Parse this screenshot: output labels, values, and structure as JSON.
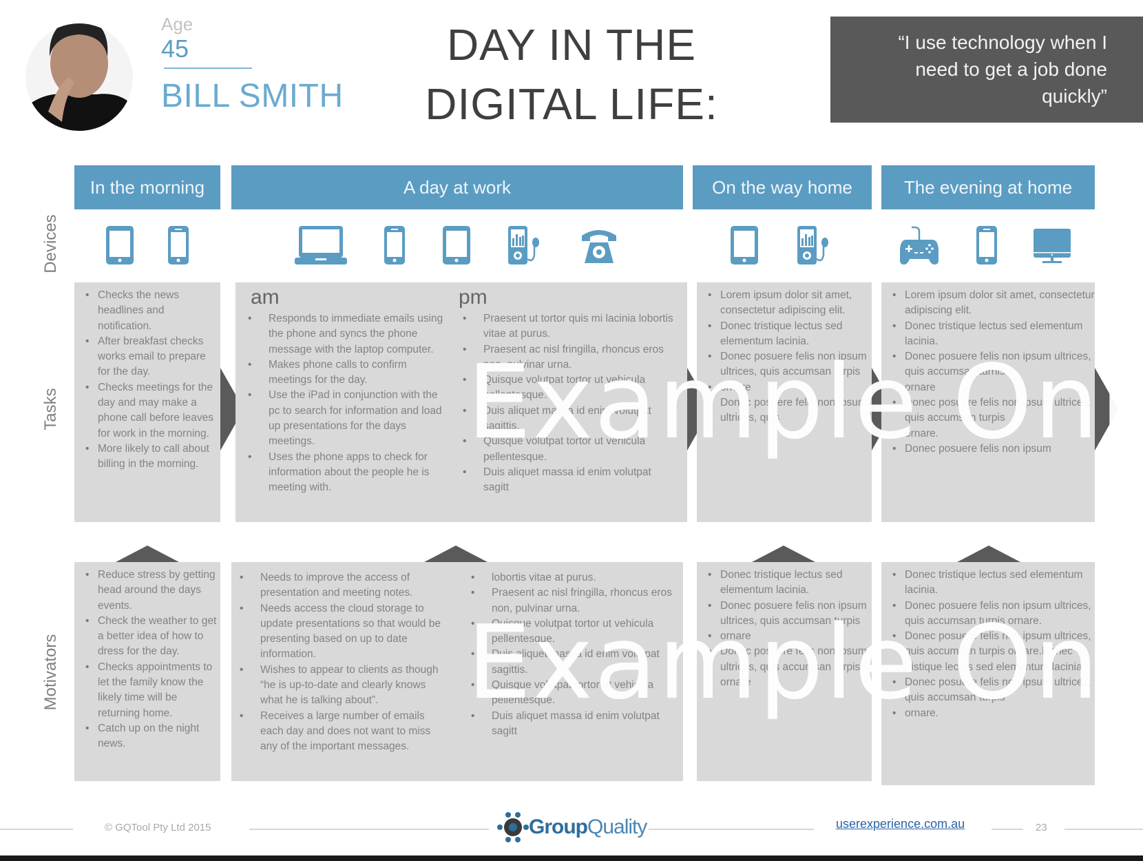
{
  "persona": {
    "age_label": "Age",
    "age_value": "45",
    "name": "BILL SMITH",
    "avatar_icon": "person-portrait-icon"
  },
  "title_line1": "DAY IN THE",
  "title_line2": "DIGITAL LIFE:",
  "quote": "“I use technology when I need to get a job done quickly”",
  "row_labels": {
    "devices": "Devices",
    "tasks": "Tasks",
    "motivators": "Motivators"
  },
  "colors": {
    "accent": "#5b9cc2",
    "box_bg": "#d9d9d9",
    "dark_gray": "#595959"
  },
  "phases": [
    {
      "label": "In the morning",
      "devices": [
        "tablet-icon",
        "smartphone-icon"
      ],
      "tasks": [
        "Checks the news headlines and notification.",
        "After breakfast checks works email to prepare for the day.",
        "Checks meetings for the day and may make a phone call before leaves for work in the morning.",
        "More likely to call about billing in the morning."
      ],
      "motivators": [
        "Reduce stress by getting head around the days events.",
        "Check the weather to get a better idea of how to dress for the day.",
        "Checks appointments to let the family know the likely time will be returning home.",
        "Catch up on the night news."
      ]
    },
    {
      "label": "A day at work",
      "devices": [
        "laptop-icon",
        "smartphone-icon",
        "tablet-icon",
        "music-player-icon",
        "desk-phone-icon"
      ],
      "am_label": "am",
      "pm_label": "pm",
      "tasks_am": [
        "Responds to immediate emails using the phone and syncs the phone message with the laptop computer.",
        "Makes phone calls to confirm meetings for the day.",
        "Use the iPad in conjunction with the pc to search for information and load up presentations for the days meetings.",
        "Uses the phone apps to check for information about the people he is meeting with."
      ],
      "tasks_pm": [
        "Praesent ut tortor quis mi lacinia lobortis vitae at purus.",
        "Praesent ac nisl fringilla, rhoncus eros non, pulvinar urna.",
        "Quisque volutpat tortor ut vehicula pellentesque.",
        "Duis aliquet massa id enim volutpat sagittis.",
        "Quisque volutpat tortor ut vehicula pellentesque.",
        "Duis aliquet massa id enim volutpat sagitt"
      ],
      "motivators_am": [
        "Needs to improve the access of presentation and meeting notes.",
        "Needs access the cloud storage to update presentations so that would be presenting based on up to date information.",
        "Wishes to appear to clients as though “he is up-to-date and clearly knows what he is talking about”.",
        "Receives a large number of emails each day and does not want to miss any of the important messages."
      ],
      "motivators_pm": [
        "lobortis vitae at purus.",
        "Praesent ac nisl fringilla, rhoncus eros non, pulvinar urna.",
        "Quisque volutpat tortor ut vehicula pellentesque.",
        "Duis aliquet massa id enim volutpat sagittis.",
        "Quisque volutpat tortor ut vehicula pellentesque.",
        "Duis aliquet massa id enim volutpat sagitt"
      ]
    },
    {
      "label": "On the way home",
      "devices": [
        "tablet-icon",
        "music-player-icon"
      ],
      "tasks": [
        "Lorem ipsum dolor sit amet, consectetur adipiscing elit.",
        "Donec tristique lectus sed elementum lacinia.",
        "Donec posuere felis non ipsum ultrices, quis accumsan turpis",
        "ornare",
        "Donec posuere felis non ipsum ultrices, quis"
      ],
      "motivators": [
        "Donec tristique lectus sed elementum lacinia.",
        "Donec posuere felis non ipsum ultrices, quis accumsan turpis",
        "ornare",
        "Donec posuere felis non ipsum ultrices, quis accumsan turpis",
        "ornare"
      ]
    },
    {
      "label": "The evening at home",
      "devices": [
        "game-controller-icon",
        "smartphone-icon",
        "desktop-monitor-icon"
      ],
      "tasks": [
        "Lorem ipsum dolor sit amet, consectetur adipiscing elit.",
        "Donec tristique lectus sed elementum lacinia.",
        "Donec posuere felis non ipsum ultrices, quis accumsan turnis",
        "ornare",
        "Donec posuere felis non ipsum ultrices, quis accumsan turpis",
        "ornare.",
        "Donec posuere felis non ipsum"
      ],
      "motivators": [
        "Donec tristique lectus sed elementum lacinia.",
        "Donec posuere felis non ipsum ultrices, quis accumsan turpis ornare.",
        "Donec posuere felis non ipsum ultrices, quis accumsan turpis ornare.Donec tristique lectus sed elementum lacinia.",
        "Donec posuere felis non ipsum ultrices, quis accumsan turpis",
        "ornare."
      ]
    }
  ],
  "watermark": "Example Only",
  "footer": {
    "copyright": "© GQTool Pty Ltd 2015",
    "logo_text_a": "Group",
    "logo_text_b": "Quality",
    "website": "userexperience.com.au",
    "page_number": "23"
  }
}
